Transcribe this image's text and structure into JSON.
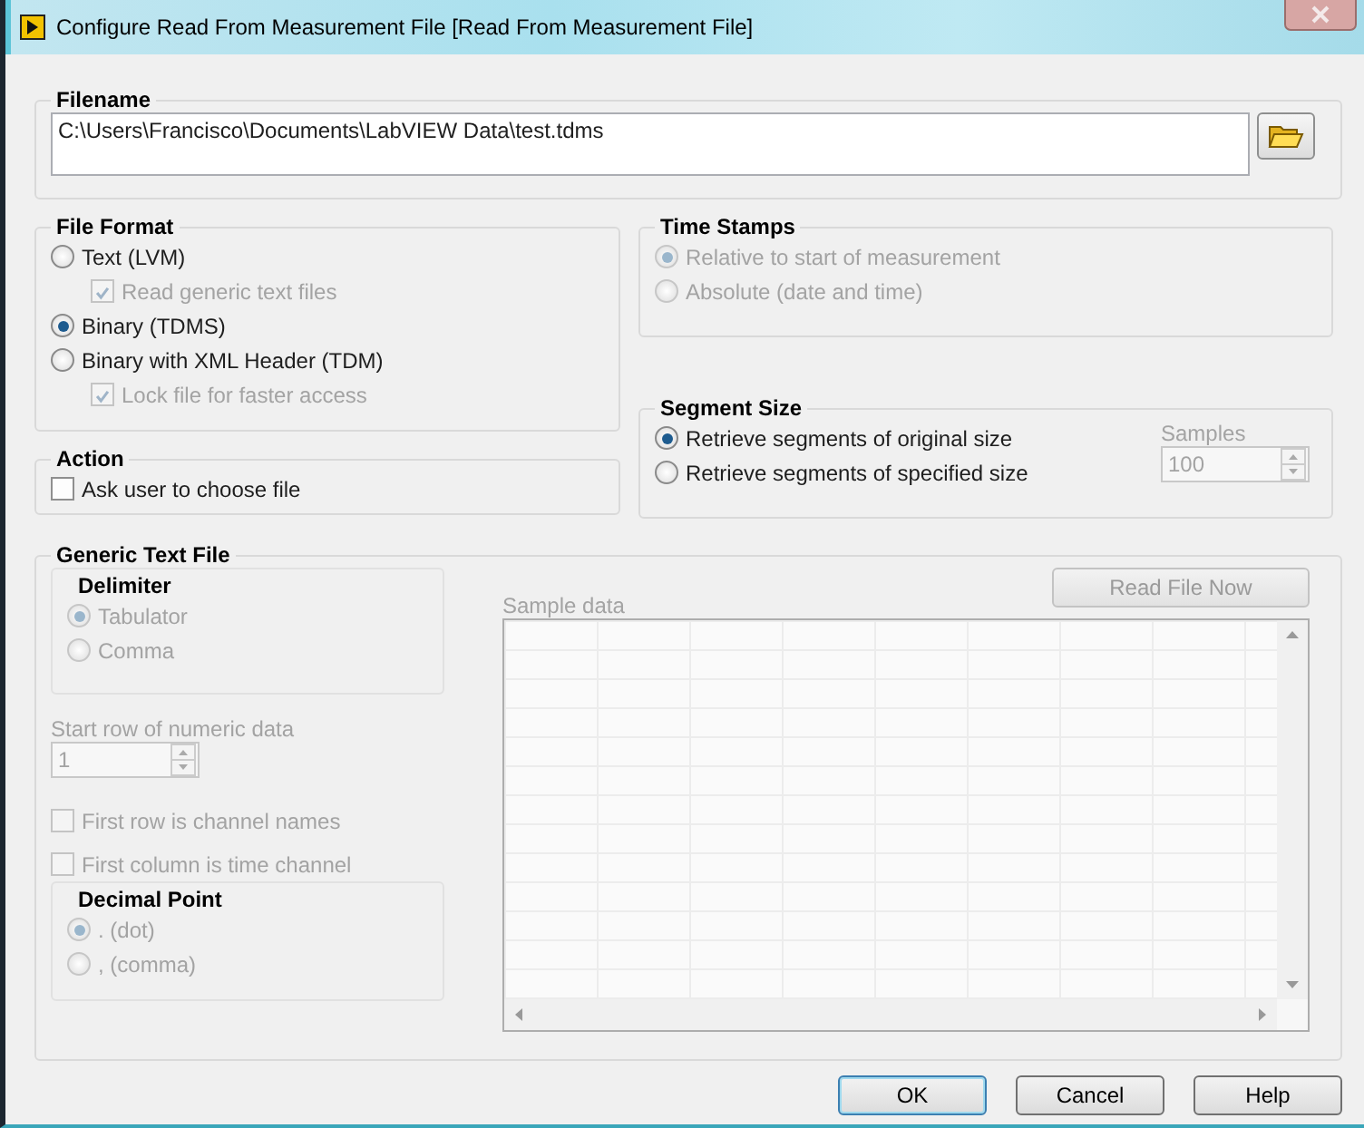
{
  "window": {
    "title": "Configure Read From Measurement File [Read From Measurement File]"
  },
  "filename": {
    "label": "Filename",
    "value": "C:\\Users\\Francisco\\Documents\\LabVIEW Data\\test.tdms"
  },
  "file_format": {
    "title": "File Format",
    "options": [
      {
        "label": "Text (LVM)",
        "selected": false,
        "sub_option": {
          "label": "Read generic text files",
          "checked": true,
          "disabled": true
        }
      },
      {
        "label": "Binary (TDMS)",
        "selected": true
      },
      {
        "label": "Binary with XML Header (TDM)",
        "selected": false,
        "sub_option": {
          "label": "Lock file for faster access",
          "checked": true,
          "disabled": true
        }
      }
    ]
  },
  "action": {
    "title": "Action",
    "options": [
      {
        "label": "Ask user to choose file",
        "checked": false
      }
    ]
  },
  "time_stamps": {
    "title": "Time Stamps",
    "disabled": true,
    "options": [
      {
        "label": "Relative to start of measurement",
        "selected": true
      },
      {
        "label": "Absolute (date and time)",
        "selected": false
      }
    ]
  },
  "segment_size": {
    "title": "Segment Size",
    "options": [
      {
        "label": "Retrieve segments of original size",
        "selected": true
      },
      {
        "label": "Retrieve segments of specified size",
        "selected": false
      }
    ],
    "samples": {
      "label": "Samples",
      "value": "100",
      "disabled": true
    }
  },
  "generic_text_file": {
    "title": "Generic Text File",
    "disabled": true,
    "delimiter": {
      "title": "Delimiter",
      "options": [
        {
          "label": "Tabulator",
          "selected": true
        },
        {
          "label": "Comma",
          "selected": false
        }
      ]
    },
    "start_row": {
      "label": "Start row of numeric data",
      "value": "1"
    },
    "checks": [
      {
        "label": "First row is channel names",
        "checked": false
      },
      {
        "label": "First column is time channel",
        "checked": false
      }
    ],
    "decimal_point": {
      "title": "Decimal Point",
      "options": [
        {
          "label": ". (dot)",
          "selected": true
        },
        {
          "label": ", (comma)",
          "selected": false
        }
      ]
    },
    "sample_data": {
      "label": "Sample data"
    },
    "read_button": {
      "label": "Read File Now",
      "disabled": true
    }
  },
  "buttons": [
    {
      "label": "OK",
      "default": true
    },
    {
      "label": "Cancel",
      "default": false
    },
    {
      "label": "Help",
      "default": false
    }
  ]
}
